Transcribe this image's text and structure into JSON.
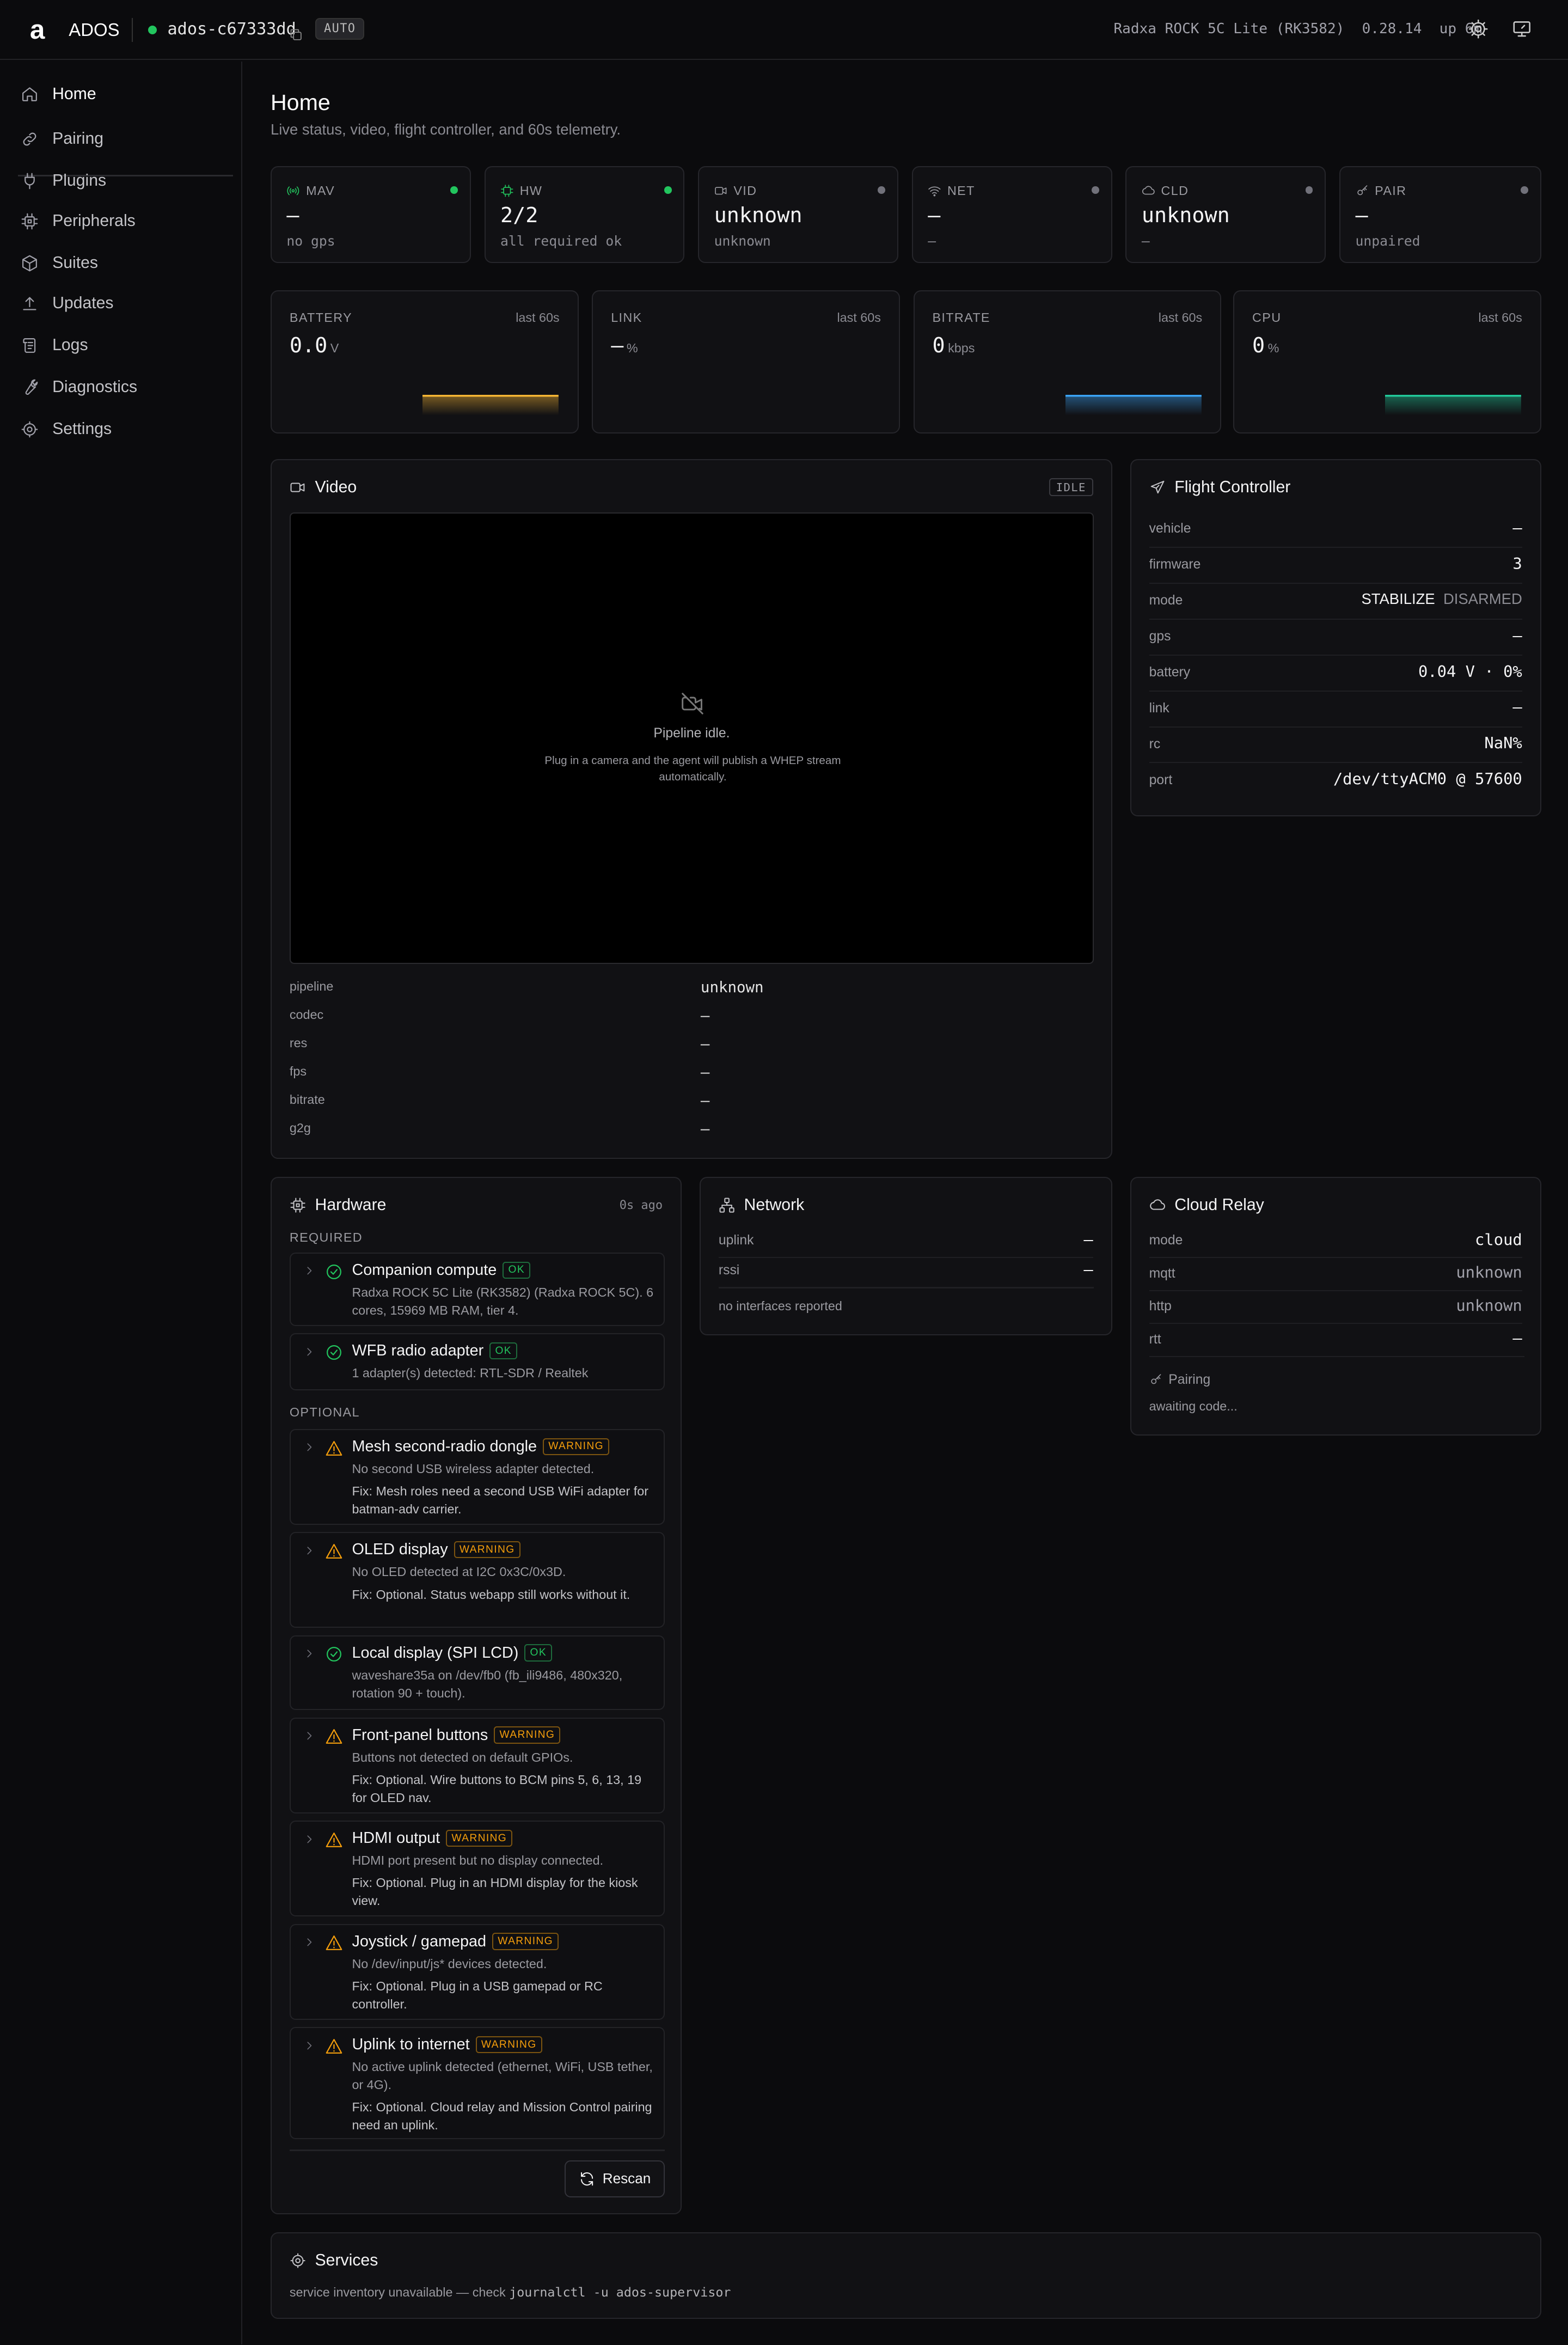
{
  "header": {
    "logo": "a",
    "app_name": "ADOS",
    "hostname": "ados-c67333dd",
    "mode_badge": "AUTO",
    "device": "Radxa ROCK 5C Lite (RK3582)",
    "version": "0.28.14",
    "uptime": "up 6m"
  },
  "sidebar": {
    "items": [
      {
        "label": "Home",
        "icon": "home-icon"
      },
      {
        "label": "Pairing",
        "icon": "link-icon"
      },
      {
        "label": "Plugins",
        "icon": "plug-icon"
      },
      {
        "label": "Peripherals",
        "icon": "chip-icon"
      },
      {
        "label": "Suites",
        "icon": "box-icon"
      },
      {
        "label": "Updates",
        "icon": "upload-icon"
      },
      {
        "label": "Logs",
        "icon": "scroll-icon"
      },
      {
        "label": "Diagnostics",
        "icon": "wrench-icon"
      },
      {
        "label": "Settings",
        "icon": "gear-icon"
      }
    ]
  },
  "page": {
    "title": "Home",
    "subtitle": "Live status, video, flight controller, and 60s telemetry."
  },
  "status_tiles": [
    {
      "label": "MAV",
      "value": "—",
      "sub": "no gps",
      "active": true
    },
    {
      "label": "HW",
      "value": "2/2",
      "sub": "all required ok",
      "active": true
    },
    {
      "label": "VID",
      "value": "unknown",
      "sub": "unknown",
      "active": false
    },
    {
      "label": "NET",
      "value": "—",
      "sub": "—",
      "active": false
    },
    {
      "label": "CLD",
      "value": "unknown",
      "sub": "—",
      "active": false
    },
    {
      "label": "PAIR",
      "value": "—",
      "sub": "unpaired",
      "active": false
    }
  ],
  "telemetry": [
    {
      "label": "BATTERY",
      "period": "last 60s",
      "value": "0.0",
      "unit": "V",
      "color": "#f5b534"
    },
    {
      "label": "LINK",
      "period": "last 60s",
      "value": "—",
      "unit": "%",
      "color": ""
    },
    {
      "label": "BITRATE",
      "period": "last 60s",
      "value": "0",
      "unit": "kbps",
      "color": "#3ba3f5"
    },
    {
      "label": "CPU",
      "period": "last 60s",
      "value": "0",
      "unit": "%",
      "color": "#22c99a"
    }
  ],
  "video": {
    "title": "Video",
    "state_badge": "IDLE",
    "message": "Pipeline idle.",
    "hint": "Plug in a camera and the agent will publish a WHEP stream automatically.",
    "rows": [
      {
        "key": "pipeline",
        "value": "unknown"
      },
      {
        "key": "codec",
        "value": "—"
      },
      {
        "key": "res",
        "value": "—"
      },
      {
        "key": "fps",
        "value": "—"
      },
      {
        "key": "bitrate",
        "value": "—"
      },
      {
        "key": "g2g",
        "value": "—"
      }
    ]
  },
  "flight_controller": {
    "title": "Flight Controller",
    "rows": [
      {
        "key": "vehicle",
        "value": "—"
      },
      {
        "key": "firmware",
        "value": "3"
      },
      {
        "key": "mode",
        "value": "STABILIZE",
        "extra": "DISARMED"
      },
      {
        "key": "gps",
        "value": "—"
      },
      {
        "key": "battery",
        "value": "0.04 V · 0%"
      },
      {
        "key": "link",
        "value": "—"
      },
      {
        "key": "rc",
        "value": "NaN%"
      },
      {
        "key": "port",
        "value": "/dev/ttyACM0 @ 57600"
      }
    ]
  },
  "hardware": {
    "title": "Hardware",
    "updated": "0s ago",
    "required_label": "REQUIRED",
    "optional_label": "OPTIONAL",
    "required": [
      {
        "name": "Companion compute",
        "status": "OK",
        "desc": "Radxa ROCK 5C Lite (RK3582) (Radxa ROCK 5C). 6 cores, 15969 MB RAM, tier 4.",
        "fix": ""
      },
      {
        "name": "WFB radio adapter",
        "status": "OK",
        "desc": "1 adapter(s) detected: RTL-SDR / Realtek",
        "fix": ""
      }
    ],
    "optional": [
      {
        "name": "Mesh second-radio dongle",
        "status": "WARNING",
        "desc": "No second USB wireless adapter detected.",
        "fix": "Fix: Mesh roles need a second USB WiFi adapter for batman-adv carrier."
      },
      {
        "name": "OLED display",
        "status": "WARNING",
        "desc": "No OLED detected at I2C 0x3C/0x3D.",
        "fix": "Fix: Optional. Status webapp still works without it."
      },
      {
        "name": "Local display (SPI LCD)",
        "status": "OK",
        "desc": "waveshare35a on /dev/fb0 (fb_ili9486, 480x320, rotation 90 + touch).",
        "fix": ""
      },
      {
        "name": "Front-panel buttons",
        "status": "WARNING",
        "desc": "Buttons not detected on default GPIOs.",
        "fix": "Fix: Optional. Wire buttons to BCM pins 5, 6, 13, 19 for OLED nav."
      },
      {
        "name": "HDMI output",
        "status": "WARNING",
        "desc": "HDMI port present but no display connected.",
        "fix": "Fix: Optional. Plug in an HDMI display for the kiosk view."
      },
      {
        "name": "Joystick / gamepad",
        "status": "WARNING",
        "desc": "No /dev/input/js* devices detected.",
        "fix": "Fix: Optional. Plug in a USB gamepad or RC controller."
      },
      {
        "name": "Uplink to internet",
        "status": "WARNING",
        "desc": "No active uplink detected (ethernet, WiFi, USB tether, or 4G).",
        "fix": "Fix: Optional. Cloud relay and Mission Control pairing need an uplink."
      }
    ],
    "rescan_label": "Rescan"
  },
  "network": {
    "title": "Network",
    "rows": [
      {
        "key": "uplink",
        "value": "—"
      },
      {
        "key": "rssi",
        "value": "—"
      }
    ],
    "empty": "no interfaces reported"
  },
  "cloud_relay": {
    "title": "Cloud Relay",
    "rows": [
      {
        "key": "mode",
        "value": "cloud"
      },
      {
        "key": "mqtt",
        "value": "unknown"
      },
      {
        "key": "http",
        "value": "unknown"
      },
      {
        "key": "rtt",
        "value": "—"
      }
    ],
    "pairing_label": "Pairing",
    "pairing_state": "awaiting code..."
  },
  "services": {
    "title": "Services",
    "message": "service inventory unavailable — check",
    "command": "journalctl -u ados-supervisor"
  }
}
